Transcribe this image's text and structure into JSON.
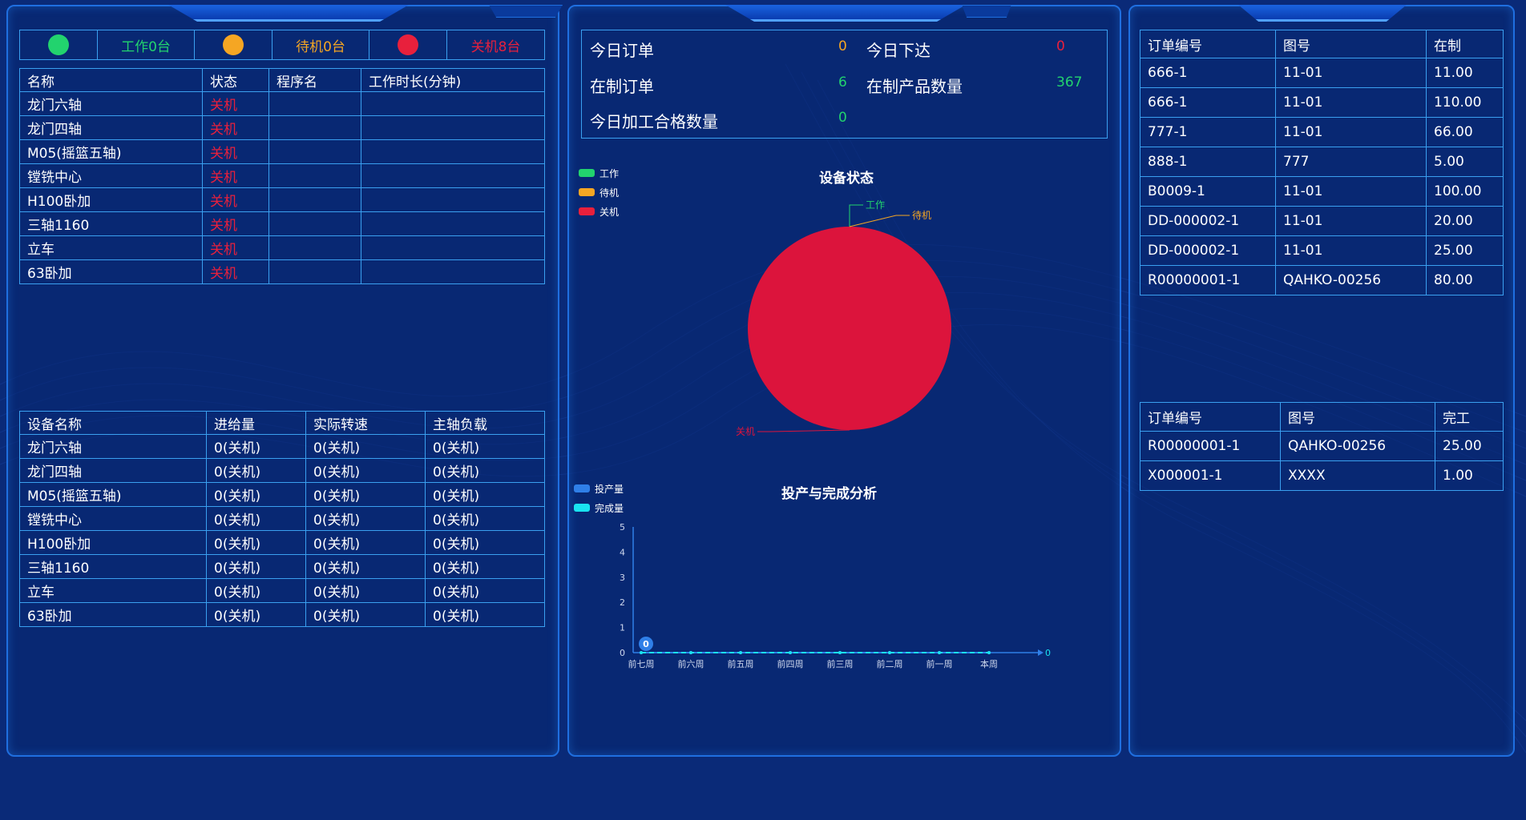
{
  "colors": {
    "working": "#22d36e",
    "standby": "#f5a623",
    "off": "#e8203c",
    "border": "#3aa0f0",
    "background": "#0a2a78"
  },
  "status_bar": {
    "working_label": "工作0台",
    "standby_label": "待机0台",
    "off_label": "关机8台"
  },
  "machine_table": {
    "headers": [
      "名称",
      "状态",
      "程序名",
      "工作时长(分钟)"
    ],
    "rows": [
      [
        "龙门六轴",
        "关机",
        "",
        ""
      ],
      [
        "龙门四轴",
        "关机",
        "",
        ""
      ],
      [
        "M05(摇篮五轴)",
        "关机",
        "",
        ""
      ],
      [
        "镗铣中心",
        "关机",
        "",
        ""
      ],
      [
        "H100卧加",
        "关机",
        "",
        ""
      ],
      [
        "三轴1160",
        "关机",
        "",
        ""
      ],
      [
        "立车",
        "关机",
        "",
        ""
      ],
      [
        "63卧加",
        "关机",
        "",
        ""
      ]
    ]
  },
  "spindle_table": {
    "headers": [
      "设备名称",
      "进给量",
      "实际转速",
      "主轴负载"
    ],
    "rows": [
      [
        "龙门六轴",
        "0(关机)",
        "0(关机)",
        "0(关机)"
      ],
      [
        "龙门四轴",
        "0(关机)",
        "0(关机)",
        "0(关机)"
      ],
      [
        "M05(摇篮五轴)",
        "0(关机)",
        "0(关机)",
        "0(关机)"
      ],
      [
        "镗铣中心",
        "0(关机)",
        "0(关机)",
        "0(关机)"
      ],
      [
        "H100卧加",
        "0(关机)",
        "0(关机)",
        "0(关机)"
      ],
      [
        "三轴1160",
        "0(关机)",
        "0(关机)",
        "0(关机)"
      ],
      [
        "立车",
        "0(关机)",
        "0(关机)",
        "0(关机)"
      ],
      [
        "63卧加",
        "0(关机)",
        "0(关机)",
        "0(关机)"
      ]
    ]
  },
  "kpi": {
    "today_orders_label": "今日订单",
    "today_orders": "0",
    "today_issued_label": "今日下达",
    "today_issued": "0",
    "wip_orders_label": "在制订单",
    "wip_orders": "6",
    "wip_products_label": "在制产品数量",
    "wip_products": "367",
    "today_qualified_label": "今日加工合格数量",
    "today_qualified": "0"
  },
  "chart_data": [
    {
      "type": "pie",
      "title": "设备状态",
      "legend": [
        "工作",
        "待机",
        "关机"
      ],
      "legend_position": "top-left",
      "slices": [
        {
          "name": "工作",
          "value": 0,
          "color": "#22d36e"
        },
        {
          "name": "待机",
          "value": 0,
          "color": "#f5a623"
        },
        {
          "name": "关机",
          "value": 8,
          "color": "#dc143c"
        }
      ]
    },
    {
      "type": "line",
      "title": "投产与完成分析",
      "legend_position": "top-left",
      "categories": [
        "前七周",
        "前六周",
        "前五周",
        "前四周",
        "前三周",
        "前二周",
        "前一周",
        "本周"
      ],
      "series": [
        {
          "name": "投产量",
          "values": [
            0,
            0,
            0,
            0,
            0,
            0,
            0,
            0
          ],
          "color": "#2f7fe8"
        },
        {
          "name": "完成量",
          "values": [
            0,
            0,
            0,
            0,
            0,
            0,
            0,
            0
          ],
          "color": "#19e3f0"
        }
      ],
      "ylim": [
        0,
        5
      ],
      "yticks": [
        "0",
        "1",
        "2",
        "3",
        "4",
        "5"
      ],
      "point_label": "0",
      "end_label": "0",
      "grid": false
    }
  ],
  "wip_table": {
    "headers": [
      "订单编号",
      "图号",
      "在制"
    ],
    "rows": [
      [
        "666-1",
        "11-01",
        "11.00"
      ],
      [
        "666-1",
        "11-01",
        "110.00"
      ],
      [
        "777-1",
        "11-01",
        "66.00"
      ],
      [
        "888-1",
        "777",
        "5.00"
      ],
      [
        "B0009-1",
        "11-01",
        "100.00"
      ],
      [
        "DD-000002-1",
        "11-01",
        "20.00"
      ],
      [
        "DD-000002-1",
        "11-01",
        "25.00"
      ],
      [
        "R00000001-1",
        "QAHKO-00256",
        "80.00"
      ]
    ]
  },
  "done_table": {
    "headers": [
      "订单编号",
      "图号",
      "完工"
    ],
    "rows": [
      [
        "R00000001-1",
        "QAHKO-00256",
        "25.00"
      ],
      [
        "X000001-1",
        "XXXX",
        "1.00"
      ]
    ]
  }
}
